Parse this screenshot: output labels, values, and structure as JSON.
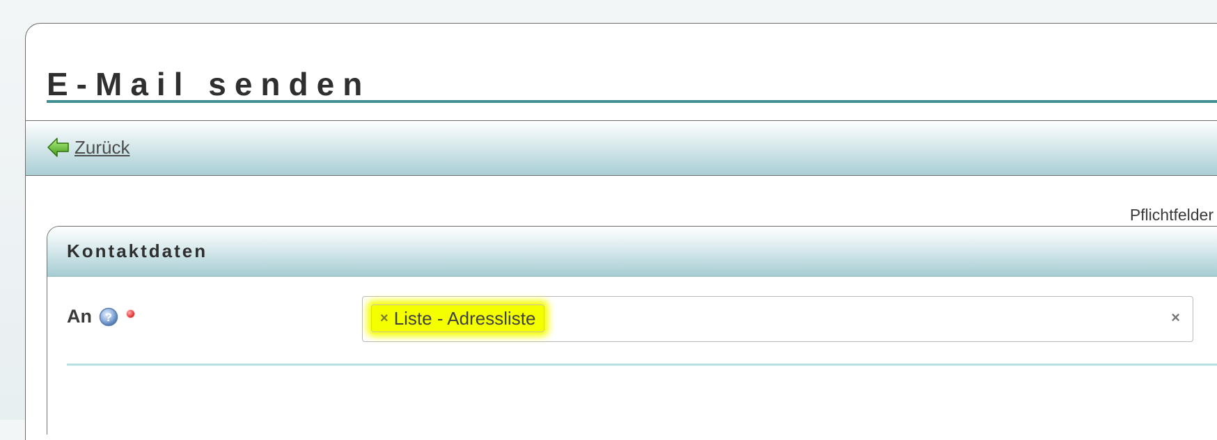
{
  "page": {
    "title": "E-Mail senden"
  },
  "toolbar": {
    "back_label": "Zurück"
  },
  "required_note": {
    "label": "Pflichtfelder"
  },
  "panel": {
    "title": "Kontaktdaten",
    "fields": [
      {
        "label": "An",
        "selected": [
          "Liste - Adressliste"
        ],
        "chip_remove_symbol": "×",
        "clear_symbol": "×"
      }
    ]
  },
  "icons": {
    "back": "arrow-left-icon",
    "help": "help-icon",
    "required": "required-dot-icon"
  },
  "colors": {
    "accent_teal": "#3f8e90",
    "header_gradient_end": "#a6cdd3",
    "highlight_yellow": "#f4ff00",
    "required_red": "#e53838"
  }
}
